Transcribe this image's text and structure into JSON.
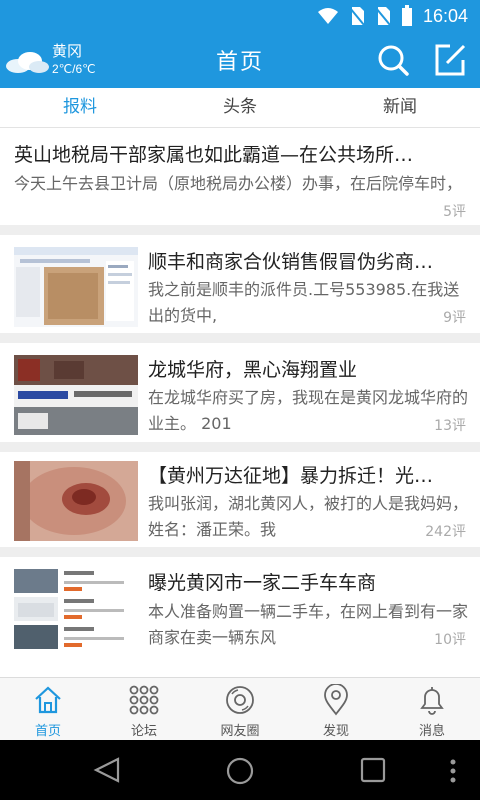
{
  "status_bar": {
    "time": "16:04",
    "icons": [
      "wifi-icon",
      "no-sim-icon",
      "no-sim-icon",
      "battery-icon"
    ]
  },
  "header": {
    "weather": {
      "city": "黄冈",
      "temp": "2℃/6℃"
    },
    "title": "首页"
  },
  "tabs": [
    {
      "label": "报料",
      "active": true
    },
    {
      "label": "头条",
      "active": false
    },
    {
      "label": "新闻",
      "active": false
    }
  ],
  "feed": [
    {
      "headline": "英山地税局干部家属也如此霸道—在公共场所…",
      "summary": "今天上午去县卫计局（原地税局办公楼）办事，在后院停车时，",
      "comments": "5评"
    },
    {
      "headline": "顺丰和商家合伙销售假冒伪劣商…",
      "summary": "我之前是顺丰的派件员.工号553985.在我送出的货中,",
      "comments": "9评"
    },
    {
      "headline": "龙城华府，黑心海翔置业",
      "summary": "在龙城华府买了房，我现在是黄冈龙城华府的业主。 201",
      "comments": "13评"
    },
    {
      "headline": "【黄州万达征地】暴力拆迁！光…",
      "summary": "我叫张润，湖北黄冈人，被打的人是我妈妈，姓名：潘正荣。我",
      "comments": "242评"
    },
    {
      "headline": "曝光黄冈市一家二手车车商",
      "summary": "本人准备购置一辆二手车，在网上看到有一家商家在卖一辆东风",
      "comments": "10评"
    }
  ],
  "bottom_nav": [
    {
      "label": "首页",
      "icon": "home-icon",
      "active": true
    },
    {
      "label": "论坛",
      "icon": "grid-icon",
      "active": false
    },
    {
      "label": "网友圈",
      "icon": "disc-icon",
      "active": false
    },
    {
      "label": "发现",
      "icon": "location-pin-icon",
      "active": false
    },
    {
      "label": "消息",
      "icon": "bell-icon",
      "active": false
    }
  ],
  "colors": {
    "accent": "#1f97de",
    "divider": "#eeeeee"
  }
}
